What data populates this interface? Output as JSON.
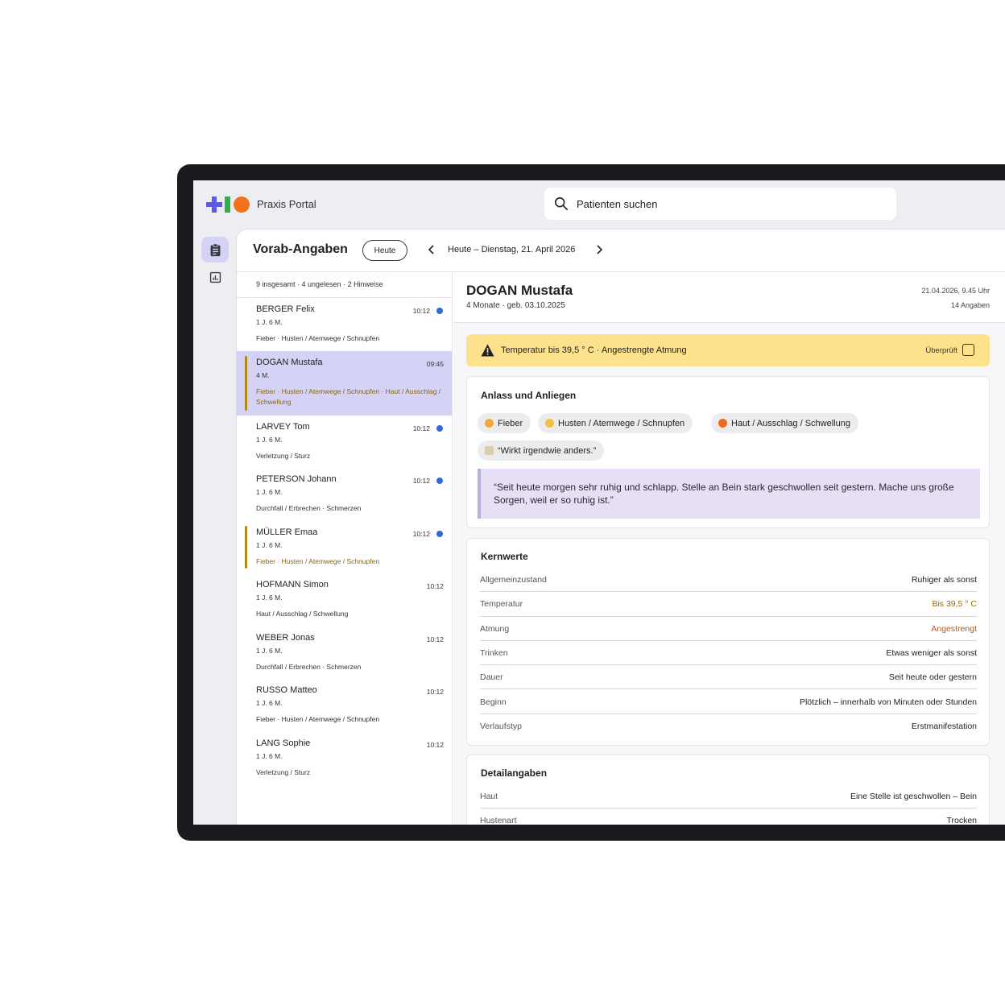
{
  "app": {
    "title": "Praxis Portal"
  },
  "search": {
    "placeholder": "Patienten suchen"
  },
  "header": {
    "title": "Vorab-Angaben",
    "today_button": "Heute",
    "date_label": "Heute – Dienstag, 21. April 2026"
  },
  "list": {
    "summary": "9 insgesamt · 4 ungelesen  · 2 Hinweise",
    "items": [
      {
        "name": "BERGER Felix",
        "age": "1 J. 6 M.",
        "tags": "Fieber · Husten / Atemwege / Schnupfen",
        "time": "10:12",
        "unread": true
      },
      {
        "name": "DOGAN Mustafa",
        "age": "4 M.",
        "tags": "Fieber · Husten / Atemwege / Schnupfen · Haut / Ausschlag / Schwellung",
        "time": "09:45",
        "selected": true,
        "flag": true
      },
      {
        "name": "LARVEY Tom",
        "age": "1 J. 6 M.",
        "tags": "Verletzung / Sturz",
        "time": "10:12",
        "unread": true
      },
      {
        "name": "PETERSON Johann",
        "age": "1 J. 6 M.",
        "tags": "Durchfall / Erbrechen · Schmerzen",
        "time": "10:12",
        "unread": true
      },
      {
        "name": "MÜLLER Emaa",
        "age": "1 J. 6 M.",
        "tags": "Fieber · Husten / Atemwege / Schnupfen",
        "time": "10:12",
        "unread": true,
        "flag": true
      },
      {
        "name": "HOFMANN Simon",
        "age": "1 J. 6 M.",
        "tags": "Haut / Ausschlag / Schwellung",
        "time": "10:12"
      },
      {
        "name": "WEBER Jonas",
        "age": "1 J. 6 M.",
        "tags": "Durchfall / Erbrechen · Schmerzen",
        "time": "10:12"
      },
      {
        "name": "RUSSO Matteo",
        "age": "1 J. 6 M.",
        "tags": "Fieber · Husten / Atemwege / Schnupfen",
        "time": "10:12"
      },
      {
        "name": "LANG Sophie",
        "age": "1 J. 6 M.",
        "tags": "Verletzung / Sturz",
        "time": "10:12"
      }
    ]
  },
  "patient": {
    "name": "DOGAN Mustafa",
    "sub": "4 Monate · geb. 03.10.2025",
    "date": "21.04.2026, 9.45 Uhr",
    "count": "14 Angaben"
  },
  "alert": {
    "text": "Temperatur bis 39,5 ° C · Angestrengte Atmung",
    "checked_label": "Überprüft"
  },
  "reason": {
    "title": "Anlass und Anliegen",
    "chips": [
      "Fieber",
      "Husten / Atemwege / Schnupfen",
      "Haut / Ausschlag / Schwellung",
      "“Wirkt irgendwie anders.”"
    ],
    "quote": "“Seit heute morgen sehr ruhig und schlapp. Stelle an Bein stark geschwollen seit gestern. Mache uns große Sorgen, weil er so ruhig ist.”"
  },
  "core": {
    "title": "Kernwerte",
    "rows": [
      {
        "k": "Allgemeinzustand",
        "v": "Ruhiger als sonst"
      },
      {
        "k": "Temperatur",
        "v": "Bis 39,5 ° C"
      },
      {
        "k": "Atmung",
        "v": "Angestrengt"
      },
      {
        "k": "Trinken",
        "v": "Etwas weniger als sonst"
      },
      {
        "k": "Dauer",
        "v": "Seit heute oder gestern"
      },
      {
        "k": "Beginn",
        "v": "Plötzlich – innerhalb von Minuten oder Stunden"
      },
      {
        "k": "Verlaufstyp",
        "v": "Erstmanifestation"
      }
    ]
  },
  "details": {
    "title": "Detailangaben",
    "rows": [
      {
        "k": "Haut",
        "v": "Eine Stelle ist geschwollen – Bein"
      },
      {
        "k": "Hustenart",
        "v": "Trocken"
      }
    ]
  },
  "colors": {
    "accent": "#d4d3f6",
    "alert": "#fde28e",
    "unread_dot": "#2f6bd6",
    "flag": "#b38a12"
  }
}
